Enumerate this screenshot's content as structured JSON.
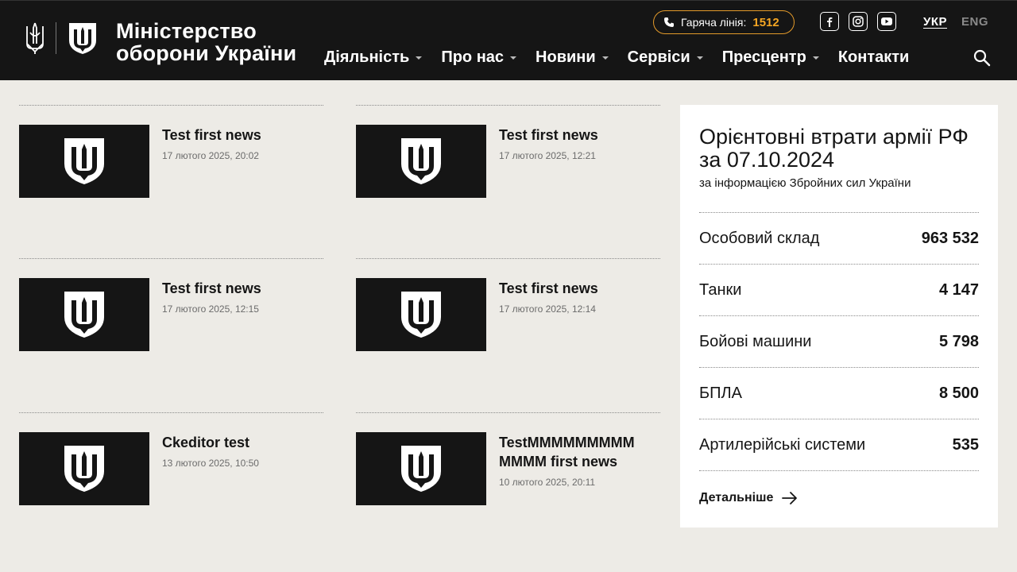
{
  "header": {
    "logo_text_line1": "Міністерство",
    "logo_text_line2": "оборони України",
    "hotline_label": "Гаряча лінія:",
    "hotline_number": "1512",
    "lang_active": "УКР",
    "lang_inactive": "ENG",
    "nav": [
      "Діяльність",
      "Про нас",
      "Новини",
      "Сервіси",
      "Пресцентр",
      "Контакти"
    ],
    "social_icons": [
      "facebook-icon",
      "instagram-icon",
      "youtube-icon"
    ],
    "accent_color": "#f5a623"
  },
  "news": [
    {
      "title": "Test first news",
      "date": "17 лютого 2025, 20:02"
    },
    {
      "title": "Test first news",
      "date": "17 лютого 2025, 12:21"
    },
    {
      "title": "Test first news",
      "date": "17 лютого 2025, 12:15"
    },
    {
      "title": "Test first news",
      "date": "17 лютого 2025, 12:14"
    },
    {
      "title": "Ckeditor test",
      "date": "13 лютого 2025, 10:50"
    },
    {
      "title": "TestMMMMMMMMM MMMM first news",
      "date": "10 лютого 2025, 20:11"
    }
  ],
  "losses": {
    "title": "Орієнтовні втрати армії РФ за 07.10.2024",
    "subtitle": "за інформацією Збройних сил України",
    "rows": [
      {
        "label": "Особовий склад",
        "value": "963 532"
      },
      {
        "label": "Танки",
        "value": "4 147"
      },
      {
        "label": "Бойові машини",
        "value": "5 798"
      },
      {
        "label": "БПЛА",
        "value": "8 500"
      },
      {
        "label": "Артилерійські системи",
        "value": "535"
      }
    ],
    "more_label": "Детальніше"
  }
}
